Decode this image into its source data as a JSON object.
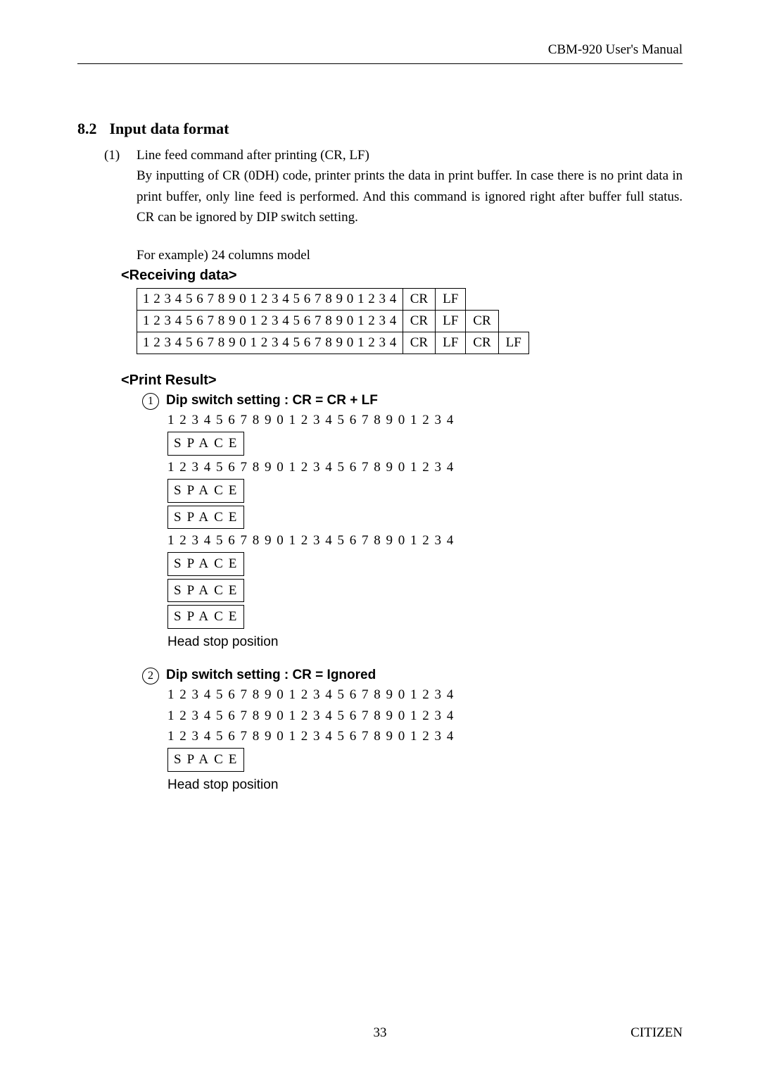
{
  "header": {
    "manual_title": "CBM-920 User's Manual"
  },
  "section": {
    "number": "8.2",
    "title": "Input data format"
  },
  "item1": {
    "num": "(1)",
    "title": "Line feed command after printing (CR, LF)",
    "body": "By inputting of CR (0DH) code, printer prints the data in print buffer. In case there is no print data in print buffer, only line feed is performed. And this command is ignored right after buffer full status. CR can be ignored by DIP switch setting."
  },
  "example_caption": "For example) 24 columns model",
  "recv_heading": "<Receiving data>",
  "recv_rows": [
    {
      "seq": "1 2 3 4 5 6 7 8 9 0 1 2 3 4 5 6 7 8 9 0 1 2 3 4",
      "cells": [
        "CR",
        "LF"
      ]
    },
    {
      "seq": "1 2 3 4 5 6 7 8 9 0 1 2 3 4 5 6 7 8 9 0 1 2 3 4",
      "cells": [
        "CR",
        "LF",
        "CR"
      ]
    },
    {
      "seq": "1 2 3 4 5 6 7 8 9 0 1 2 3 4 5 6 7 8 9 0 1 2 3 4",
      "cells": [
        "CR",
        "LF",
        "CR",
        "LF"
      ]
    }
  ],
  "print_heading": "<Print Result>",
  "case1": {
    "num": "1",
    "label": "Dip switch setting : CR = CR + LF",
    "lines": [
      {
        "type": "seq",
        "text": "1 2 3 4 5 6 7 8 9 0 1 2 3 4 5 6 7 8 9 0 1 2 3 4"
      },
      {
        "type": "box",
        "text": "SPACE"
      },
      {
        "type": "seq",
        "text": "1 2 3 4 5 6 7 8 9 0 1 2 3 4 5 6 7 8 9 0 1 2 3 4"
      },
      {
        "type": "box",
        "text": "SPACE"
      },
      {
        "type": "box",
        "text": "SPACE"
      },
      {
        "type": "seq",
        "text": "1 2 3 4 5 6 7 8 9 0 1 2 3 4 5 6 7 8 9 0 1 2 3 4"
      },
      {
        "type": "box",
        "text": "SPACE"
      },
      {
        "type": "box",
        "text": "SPACE"
      },
      {
        "type": "box",
        "text": "SPACE"
      }
    ],
    "footer": "Head stop position"
  },
  "case2": {
    "num": "2",
    "label": "Dip switch setting : CR = Ignored",
    "lines": [
      {
        "type": "seq",
        "text": "1 2 3 4 5 6 7 8 9 0 1 2 3 4 5 6 7 8 9 0 1 2 3 4"
      },
      {
        "type": "seq",
        "text": "1 2 3 4 5 6 7 8 9 0 1 2 3 4 5 6 7 8 9 0 1 2 3 4"
      },
      {
        "type": "seq",
        "text": "1 2 3 4 5 6 7 8 9 0 1 2 3 4 5 6 7 8 9 0 1 2 3 4"
      },
      {
        "type": "box",
        "text": "SPACE"
      }
    ],
    "footer": "Head stop position"
  },
  "footer": {
    "page_number": "33",
    "brand": "CITIZEN"
  }
}
